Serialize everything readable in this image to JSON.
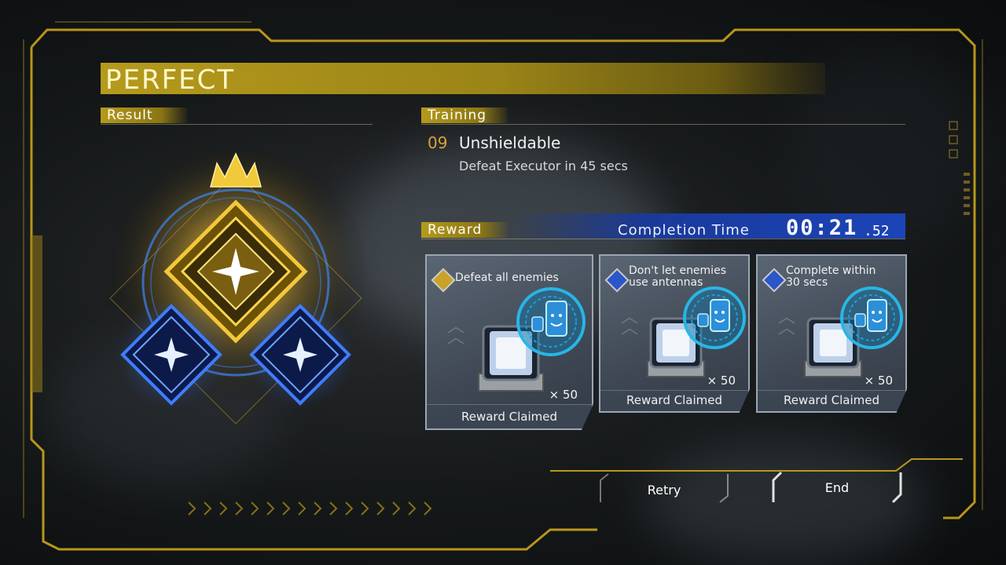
{
  "title": "PERFECT",
  "sections": {
    "result": "Result",
    "training": "Training",
    "reward": "Reward"
  },
  "training": {
    "number": "09",
    "name": "Unshieldable",
    "description": "Defeat Executor in 45 secs"
  },
  "completion": {
    "label": "Completion Time",
    "time": "00:21",
    "ms": ".52"
  },
  "rewards": [
    {
      "condition": "Defeat all enemies",
      "condition_line2": "",
      "icon": "gold-diamond-icon",
      "quantity": "× 50",
      "status": "Reward Claimed"
    },
    {
      "condition": "Don't let enemies",
      "condition_line2": "use antennas",
      "icon": "blue-diamond-icon",
      "quantity": "× 50",
      "status": "Reward Claimed"
    },
    {
      "condition": "Complete within",
      "condition_line2": "30 secs",
      "icon": "blue-diamond-icon",
      "quantity": "× 50",
      "status": "Reward Claimed"
    }
  ],
  "buttons": {
    "retry": "Retry",
    "end": "End"
  },
  "colors": {
    "gold": "#c9a227",
    "blue": "#1c44b8",
    "frame": "#b8961a"
  }
}
